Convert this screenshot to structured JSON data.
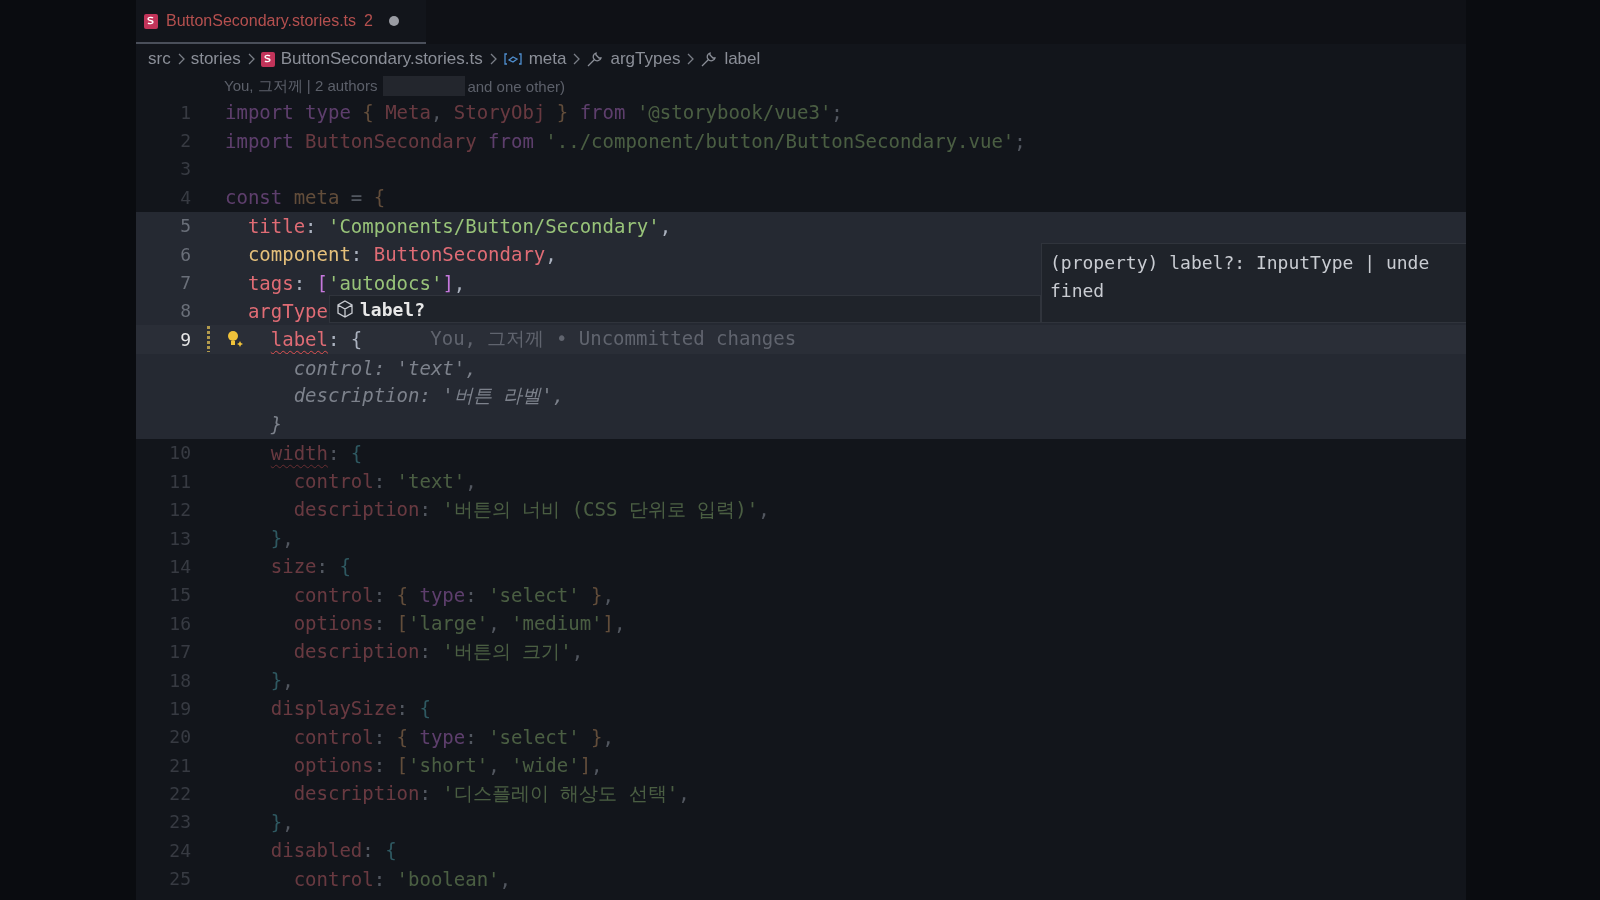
{
  "tab": {
    "label": "ButtonSecondary.stories.ts",
    "problems": "2",
    "modified": true,
    "selected": true
  },
  "breadcrumbs": [
    {
      "text": "src",
      "kind": "plain"
    },
    {
      "text": "stories",
      "kind": "plain"
    },
    {
      "text": "ButtonSecondary.stories.ts",
      "kind": "file"
    },
    {
      "text": "meta",
      "kind": "variable"
    },
    {
      "text": "argTypes",
      "kind": "property"
    },
    {
      "text": "label",
      "kind": "property"
    }
  ],
  "blame": {
    "before": "You, 그저께 | 2 authors",
    "after": "and one other)"
  },
  "lines": [
    {
      "number": "1",
      "focused": false,
      "current": false,
      "tokens": [
        {
          "kind": "keyword",
          "text": "import "
        },
        {
          "kind": "keyword",
          "text": "type "
        },
        {
          "kind": "bracket1",
          "text": "{ "
        },
        {
          "kind": "name",
          "text": "Meta"
        },
        {
          "kind": "punct",
          "text": ", "
        },
        {
          "kind": "name",
          "text": "StoryObj"
        },
        {
          "kind": "bracket1",
          "text": " } "
        },
        {
          "kind": "keyword",
          "text": "from "
        },
        {
          "kind": "string",
          "text": "'@storybook/vue3'"
        },
        {
          "kind": "punct",
          "text": ";"
        }
      ]
    },
    {
      "number": "2",
      "focused": false,
      "current": false,
      "tokens": [
        {
          "kind": "keyword",
          "text": "import "
        },
        {
          "kind": "name",
          "text": "ButtonSecondary "
        },
        {
          "kind": "keyword",
          "text": "from "
        },
        {
          "kind": "string",
          "text": "'../component/button/ButtonSecondary.vue'"
        },
        {
          "kind": "punct",
          "text": ";"
        }
      ]
    },
    {
      "number": "3",
      "focused": false,
      "current": false
    },
    {
      "number": "4",
      "focused": false,
      "current": false,
      "tokens": [
        {
          "kind": "keyword",
          "text": "const "
        },
        {
          "kind": "variable",
          "text": "meta "
        },
        {
          "kind": "punct",
          "text": "= "
        },
        {
          "kind": "bracket1",
          "text": "{"
        }
      ],
      "children": [
        {
          "number": "5",
          "focused": true,
          "current": false,
          "tokens": [
            {
              "kind": "property",
              "text": "title"
            },
            {
              "kind": "punct",
              "text": ": "
            },
            {
              "kind": "string",
              "text": "'Components/Button/Secondary'"
            },
            {
              "kind": "punct",
              "text": ","
            }
          ]
        },
        {
          "number": "6",
          "focused": true,
          "current": false,
          "tokens": [
            {
              "kind": "field",
              "text": "component"
            },
            {
              "kind": "punct",
              "text": ": "
            },
            {
              "kind": "name",
              "text": "ButtonSecondary"
            },
            {
              "kind": "punct",
              "text": ","
            }
          ]
        },
        {
          "number": "7",
          "focused": true,
          "current": false,
          "tokens": [
            {
              "kind": "property",
              "text": "tags"
            },
            {
              "kind": "punct",
              "text": ": "
            },
            {
              "kind": "bracket2",
              "text": "["
            },
            {
              "kind": "string",
              "text": "'autodocs'"
            },
            {
              "kind": "bracket2",
              "text": "]"
            },
            {
              "kind": "punct",
              "text": ","
            }
          ]
        },
        {
          "number": "8",
          "focused": true,
          "current": false,
          "tokens": [
            {
              "kind": "property",
              "text": "argType"
            }
          ],
          "children": [
            {
              "number": "9",
              "focused": true,
              "current": true,
              "blame": "You, 그저께 • Uncommitted changes",
              "tokens": [
                {
                  "kind": "error",
                  "text": "label"
                },
                {
                  "kind": "punct",
                  "text": ": {"
                }
              ],
              "children": [
                {
                  "focused": true,
                  "current": false,
                  "tokens": [
                    {
                      "kind": "ghost",
                      "text": "control: 'text',"
                    }
                  ]
                },
                {
                  "focused": true,
                  "current": false,
                  "tokens": [
                    {
                      "kind": "ghost",
                      "text": "description: '버튼 라벨',"
                    }
                  ]
                }
              ]
            },
            {
              "focused": true,
              "current": false,
              "tokens": [
                {
                  "kind": "ghost",
                  "text": "}"
                }
              ]
            },
            {
              "number": "10",
              "focused": false,
              "current": false,
              "tokens": [
                {
                  "kind": "error",
                  "text": "width"
                },
                {
                  "kind": "punct",
                  "text": ": "
                },
                {
                  "kind": "bracket3",
                  "text": "{"
                }
              ],
              "children": [
                {
                  "number": "11",
                  "focused": false,
                  "current": false,
                  "tokens": [
                    {
                      "kind": "property",
                      "text": "control"
                    },
                    {
                      "kind": "punct",
                      "text": ": "
                    },
                    {
                      "kind": "string",
                      "text": "'text'"
                    },
                    {
                      "kind": "punct",
                      "text": ","
                    }
                  ]
                },
                {
                  "number": "12",
                  "focused": false,
                  "current": false,
                  "tokens": [
                    {
                      "kind": "property",
                      "text": "description"
                    },
                    {
                      "kind": "punct",
                      "text": ": "
                    },
                    {
                      "kind": "string",
                      "text": "'버튼의 너비 (CSS 단위로 입력)'"
                    },
                    {
                      "kind": "punct",
                      "text": ","
                    }
                  ]
                }
              ]
            },
            {
              "number": "13",
              "focused": false,
              "current": false,
              "tokens": [
                {
                  "kind": "bracket3",
                  "text": "}"
                },
                {
                  "kind": "punct",
                  "text": ","
                }
              ]
            },
            {
              "number": "14",
              "focused": false,
              "current": false,
              "tokens": [
                {
                  "kind": "property",
                  "text": "size"
                },
                {
                  "kind": "punct",
                  "text": ": "
                },
                {
                  "kind": "bracket3",
                  "text": "{"
                }
              ],
              "children": [
                {
                  "number": "15",
                  "focused": false,
                  "current": false,
                  "tokens": [
                    {
                      "kind": "property",
                      "text": "control"
                    },
                    {
                      "kind": "punct",
                      "text": ": "
                    },
                    {
                      "kind": "bracket1",
                      "text": "{ "
                    },
                    {
                      "kind": "keyword",
                      "text": "type"
                    },
                    {
                      "kind": "punct",
                      "text": ": "
                    },
                    {
                      "kind": "string",
                      "text": "'select'"
                    },
                    {
                      "kind": "bracket1",
                      "text": " }"
                    },
                    {
                      "kind": "punct",
                      "text": ","
                    }
                  ]
                },
                {
                  "number": "16",
                  "focused": false,
                  "current": false,
                  "tokens": [
                    {
                      "kind": "property",
                      "text": "options"
                    },
                    {
                      "kind": "punct",
                      "text": ": "
                    },
                    {
                      "kind": "bracket1",
                      "text": "["
                    },
                    {
                      "kind": "string",
                      "text": "'large'"
                    },
                    {
                      "kind": "punct",
                      "text": ", "
                    },
                    {
                      "kind": "string",
                      "text": "'medium'"
                    },
                    {
                      "kind": "bracket1",
                      "text": "]"
                    },
                    {
                      "kind": "punct",
                      "text": ","
                    }
                  ]
                },
                {
                  "number": "17",
                  "focused": false,
                  "current": false,
                  "tokens": [
                    {
                      "kind": "property",
                      "text": "description"
                    },
                    {
                      "kind": "punct",
                      "text": ": "
                    },
                    {
                      "kind": "string",
                      "text": "'버튼의 크기'"
                    },
                    {
                      "kind": "punct",
                      "text": ","
                    }
                  ]
                }
              ]
            },
            {
              "number": "18",
              "focused": false,
              "current": false,
              "tokens": [
                {
                  "kind": "bracket3",
                  "text": "}"
                },
                {
                  "kind": "punct",
                  "text": ","
                }
              ]
            },
            {
              "number": "19",
              "focused": false,
              "current": false,
              "tokens": [
                {
                  "kind": "property",
                  "text": "displaySize"
                },
                {
                  "kind": "punct",
                  "text": ": "
                },
                {
                  "kind": "bracket3",
                  "text": "{"
                }
              ],
              "children": [
                {
                  "number": "20",
                  "focused": false,
                  "current": false,
                  "tokens": [
                    {
                      "kind": "property",
                      "text": "control"
                    },
                    {
                      "kind": "punct",
                      "text": ": "
                    },
                    {
                      "kind": "bracket1",
                      "text": "{ "
                    },
                    {
                      "kind": "keyword",
                      "text": "type"
                    },
                    {
                      "kind": "punct",
                      "text": ": "
                    },
                    {
                      "kind": "string",
                      "text": "'select'"
                    },
                    {
                      "kind": "bracket1",
                      "text": " }"
                    },
                    {
                      "kind": "punct",
                      "text": ","
                    }
                  ]
                },
                {
                  "number": "21",
                  "focused": false,
                  "current": false,
                  "tokens": [
                    {
                      "kind": "property",
                      "text": "options"
                    },
                    {
                      "kind": "punct",
                      "text": ": "
                    },
                    {
                      "kind": "bracket1",
                      "text": "["
                    },
                    {
                      "kind": "string",
                      "text": "'short'"
                    },
                    {
                      "kind": "punct",
                      "text": ", "
                    },
                    {
                      "kind": "string",
                      "text": "'wide'"
                    },
                    {
                      "kind": "bracket1",
                      "text": "]"
                    },
                    {
                      "kind": "punct",
                      "text": ","
                    }
                  ]
                },
                {
                  "number": "22",
                  "focused": false,
                  "current": false,
                  "tokens": [
                    {
                      "kind": "property",
                      "text": "description"
                    },
                    {
                      "kind": "punct",
                      "text": ": "
                    },
                    {
                      "kind": "string",
                      "text": "'디스플레이 해상도 선택'"
                    },
                    {
                      "kind": "punct",
                      "text": ","
                    }
                  ]
                }
              ]
            },
            {
              "number": "23",
              "focused": false,
              "current": false,
              "tokens": [
                {
                  "kind": "bracket3",
                  "text": "}"
                },
                {
                  "kind": "punct",
                  "text": ","
                }
              ]
            },
            {
              "number": "24",
              "focused": false,
              "current": false,
              "tokens": [
                {
                  "kind": "property",
                  "text": "disabled"
                },
                {
                  "kind": "punct",
                  "text": ": "
                },
                {
                  "kind": "bracket3",
                  "text": "{"
                }
              ],
              "children": [
                {
                  "number": "25",
                  "focused": false,
                  "current": false,
                  "tokens": [
                    {
                      "kind": "property",
                      "text": "control"
                    },
                    {
                      "kind": "punct",
                      "text": ": "
                    },
                    {
                      "kind": "string",
                      "text": "'boolean'"
                    },
                    {
                      "kind": "punct",
                      "text": ","
                    }
                  ]
                }
              ]
            }
          ]
        }
      ]
    }
  ],
  "suggest": {
    "label": "label?"
  },
  "hover": {
    "text": "(property) label?: InputType | undefined"
  }
}
